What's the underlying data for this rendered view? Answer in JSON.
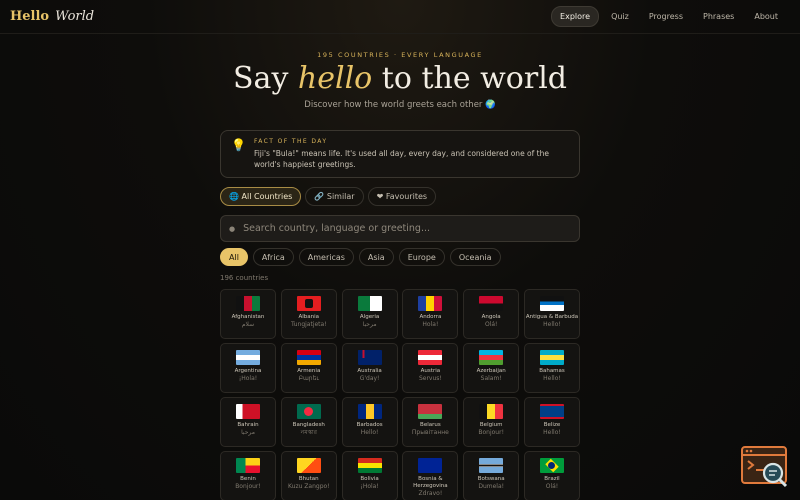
{
  "nav": {
    "logo_hello": "Hello",
    "logo_world": "World",
    "links": [
      "Explore",
      "Quiz",
      "Progress",
      "Phrases",
      "About"
    ],
    "active": "Explore"
  },
  "hero": {
    "kicker": "195 COUNTRIES · EVERY LANGUAGE",
    "title_before": "Say ",
    "title_accent": "hello",
    "title_after": " to the world",
    "subtitle": "Discover how the world greets each other 🌍"
  },
  "fact": {
    "icon": "💡",
    "label": "FACT OF THE DAY",
    "text": "Fiji's \"Bula!\" means life. It's used all day, every day, and considered one of the world's happiest greetings."
  },
  "modes": [
    {
      "icon": "🌐",
      "label": "All Countries",
      "active": true
    },
    {
      "icon": "🔗",
      "label": "Similar",
      "active": false
    },
    {
      "icon": "❤",
      "label": "Favourites",
      "active": false
    }
  ],
  "search": {
    "icon": "search-icon",
    "placeholder": "Search country, language or greeting..."
  },
  "regions": [
    {
      "label": "All",
      "active": true
    },
    {
      "label": "Africa",
      "active": false
    },
    {
      "label": "Americas",
      "active": false
    },
    {
      "label": "Asia",
      "active": false
    },
    {
      "label": "Europe",
      "active": false
    },
    {
      "label": "Oceania",
      "active": false
    }
  ],
  "count_label": "196 countries",
  "countries": [
    {
      "name": "Afghanistan",
      "greeting": "سلام",
      "flag": "af"
    },
    {
      "name": "Albania",
      "greeting": "Tungjatjeta!",
      "flag": "al"
    },
    {
      "name": "Algeria",
      "greeting": "مرحبا",
      "flag": "dz"
    },
    {
      "name": "Andorra",
      "greeting": "Hola!",
      "flag": "ad"
    },
    {
      "name": "Angola",
      "greeting": "Olá!",
      "flag": "ao"
    },
    {
      "name": "Antigua & Barbuda",
      "greeting": "Hello!",
      "flag": "ag"
    },
    {
      "name": "Argentina",
      "greeting": "¡Hola!",
      "flag": "ar"
    },
    {
      "name": "Armenia",
      "greeting": "Բարեւ",
      "flag": "am"
    },
    {
      "name": "Australia",
      "greeting": "G'day!",
      "flag": "au"
    },
    {
      "name": "Austria",
      "greeting": "Servus!",
      "flag": "at"
    },
    {
      "name": "Azerbaijan",
      "greeting": "Salam!",
      "flag": "az"
    },
    {
      "name": "Bahamas",
      "greeting": "Hello!",
      "flag": "bs"
    },
    {
      "name": "Bahrain",
      "greeting": "مرحبا",
      "flag": "bh"
    },
    {
      "name": "Bangladesh",
      "greeting": "নমস্কার",
      "flag": "bd"
    },
    {
      "name": "Barbados",
      "greeting": "Hello!",
      "flag": "bb"
    },
    {
      "name": "Belarus",
      "greeting": "Прывітанне",
      "flag": "by"
    },
    {
      "name": "Belgium",
      "greeting": "Bonjour!",
      "flag": "be"
    },
    {
      "name": "Belize",
      "greeting": "Hello!",
      "flag": "bz"
    },
    {
      "name": "Benin",
      "greeting": "Bonjour!",
      "flag": "bj"
    },
    {
      "name": "Bhutan",
      "greeting": "Kuzu Zangpo!",
      "flag": "bt"
    },
    {
      "name": "Bolivia",
      "greeting": "¡Hola!",
      "flag": "bo"
    },
    {
      "name": "Bosnia & Herzegovina",
      "greeting": "Zdravo!",
      "flag": "ba"
    },
    {
      "name": "Botswana",
      "greeting": "Dumela!",
      "flag": "bw"
    },
    {
      "name": "Brazil",
      "greeting": "Olá!",
      "flag": "br"
    }
  ],
  "colors": {
    "accent": "#e8c468",
    "background": "#0b0a09",
    "card": "#141311"
  }
}
